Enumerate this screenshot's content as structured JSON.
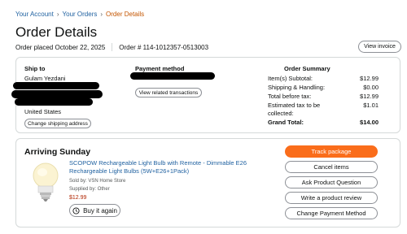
{
  "breadcrumb": {
    "items": [
      "Your Account",
      "Your Orders"
    ],
    "current": "Order Details",
    "separator": "›"
  },
  "page": {
    "title": "Order Details",
    "order_placed": "Order placed October 22, 2025",
    "order_number": "Order # 114-1012357-0513003",
    "view_invoice": "View invoice"
  },
  "shipping": {
    "heading": "Ship to",
    "name": "Gulam Yezdani",
    "country": "United States",
    "change_address": "Change shipping address"
  },
  "payment": {
    "heading": "Payment method",
    "view_transactions": "View related transactions"
  },
  "summary": {
    "heading": "Order Summary",
    "rows": [
      {
        "label": "Item(s) Subtotal:",
        "value": "$12.99"
      },
      {
        "label": "Shipping & Handling:",
        "value": "$0.00"
      },
      {
        "label": "Total before tax:",
        "value": "$12.99"
      },
      {
        "label": "Estimated tax to be collected:",
        "value": "$1.01"
      },
      {
        "label": "Grand Total:",
        "value": "$14.00"
      }
    ]
  },
  "shipment": {
    "arriving": "Arriving Sunday",
    "product_title": "SCOPOW Rechargeable Light Bulb with Remote - Dimmable E26 Rechargeable Light Bulbs (5W+E26+1Pack)",
    "sold_by": "Sold by: VSN Home Store",
    "supplied_by": "Supplied by: Other",
    "price": "$12.99",
    "buy_again": "Buy it again"
  },
  "actions": {
    "track": "Track package",
    "cancel": "Cancel items",
    "question": "Ask Product Question",
    "review": "Write a product review",
    "change_payment": "Change Payment Method"
  },
  "colors": {
    "link": "#2162a1",
    "breadcrumb_current": "#c45500",
    "primary_button": "#fa6d1b",
    "price": "#b12704"
  }
}
